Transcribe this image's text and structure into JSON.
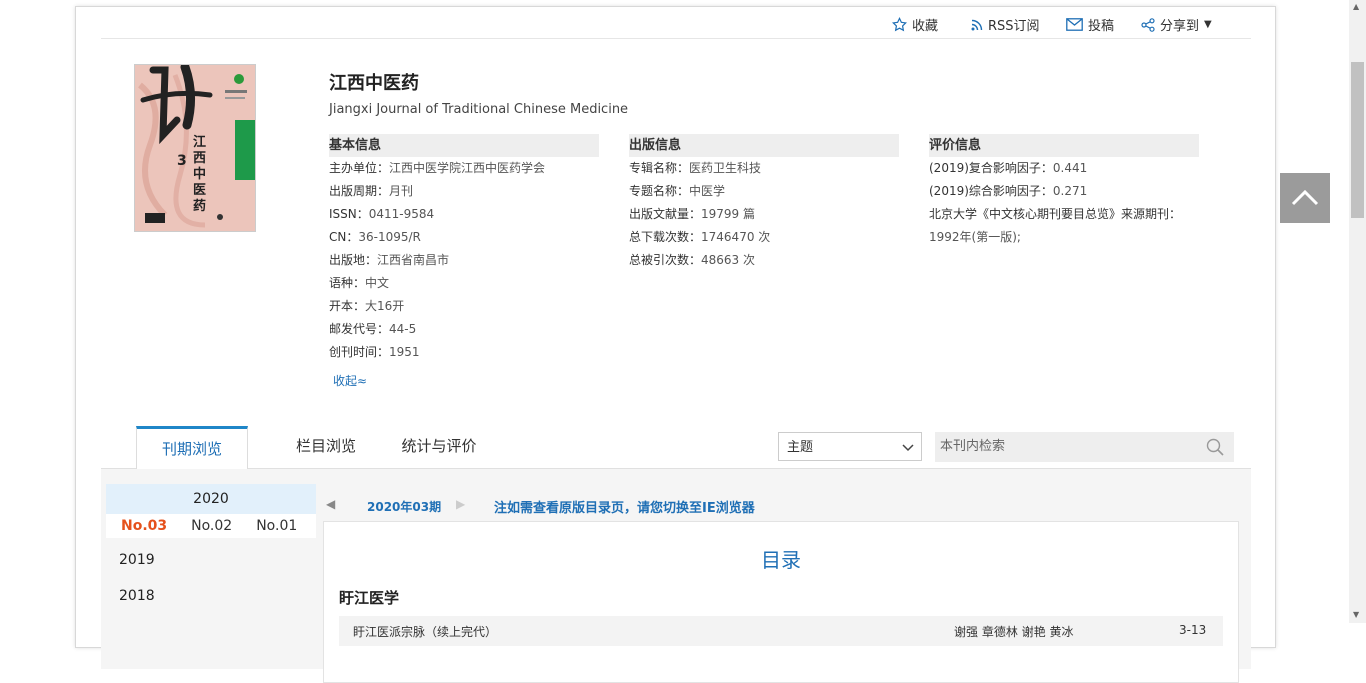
{
  "toolbar": {
    "favorite": "收藏",
    "rss": "RSS订阅",
    "submit": "投稿",
    "share": "分享到"
  },
  "journal": {
    "title": "江西中医药",
    "subtitle": "Jiangxi Journal of Traditional Chinese Medicine",
    "cover_text": "江西中医药",
    "cover_issue": "3"
  },
  "basic": {
    "heading": "基本信息",
    "rows": [
      {
        "k": "主办单位：",
        "v": "江西中医学院江西中医药学会"
      },
      {
        "k": "出版周期：",
        "v": "月刊"
      },
      {
        "k": "ISSN：",
        "v": "0411-9584"
      },
      {
        "k": "CN：",
        "v": "36-1095/R"
      },
      {
        "k": "出版地：",
        "v": "江西省南昌市"
      },
      {
        "k": "语种：",
        "v": "中文"
      },
      {
        "k": "开本：",
        "v": "大16开"
      },
      {
        "k": "邮发代号：",
        "v": "44-5"
      },
      {
        "k": "创刊时间：",
        "v": "1951"
      }
    ]
  },
  "publish": {
    "heading": "出版信息",
    "rows": [
      {
        "k": "专辑名称：",
        "v": "医药卫生科技"
      },
      {
        "k": "专题名称：",
        "v": "中医学"
      },
      {
        "k": "出版文献量：",
        "v": "19799 篇"
      },
      {
        "k": "总下载次数：",
        "v": "1746470 次"
      },
      {
        "k": "总被引次数：",
        "v": "48663 次"
      }
    ]
  },
  "evaluation": {
    "heading": "评价信息",
    "rows": [
      {
        "k": "(2019)复合影响因子：",
        "v": "0.441"
      },
      {
        "k": "(2019)综合影响因子：",
        "v": "0.271"
      },
      {
        "k": "北京大学《中文核心期刊要目总览》来源期刊：",
        "v": ""
      },
      {
        "k": "",
        "v": "1992年(第一版);"
      }
    ]
  },
  "collapse_label": "收起",
  "tabs": [
    "刊期浏览",
    "栏目浏览",
    "统计与评价"
  ],
  "search": {
    "select_value": "主题",
    "placeholder": "本刊内检索"
  },
  "years": {
    "active_year": "2020",
    "issues": [
      "No.03",
      "No.02",
      "No.01"
    ],
    "others": [
      "2019",
      "2018"
    ]
  },
  "issue_label": "2020年03期",
  "notice": "注如需查看原版目录页，请您切换至IE浏览器",
  "toc": {
    "title": "目录",
    "section": "盱江医学",
    "first_entry": {
      "title": "盱江医派宗脉（续上完代）",
      "authors": "谢强 章德林 谢艳 黄冰",
      "pages": "3-13"
    }
  },
  "colors": {
    "accent": "#1f86c8",
    "issue_active": "#e5511c",
    "link": "#1f6fb5"
  }
}
